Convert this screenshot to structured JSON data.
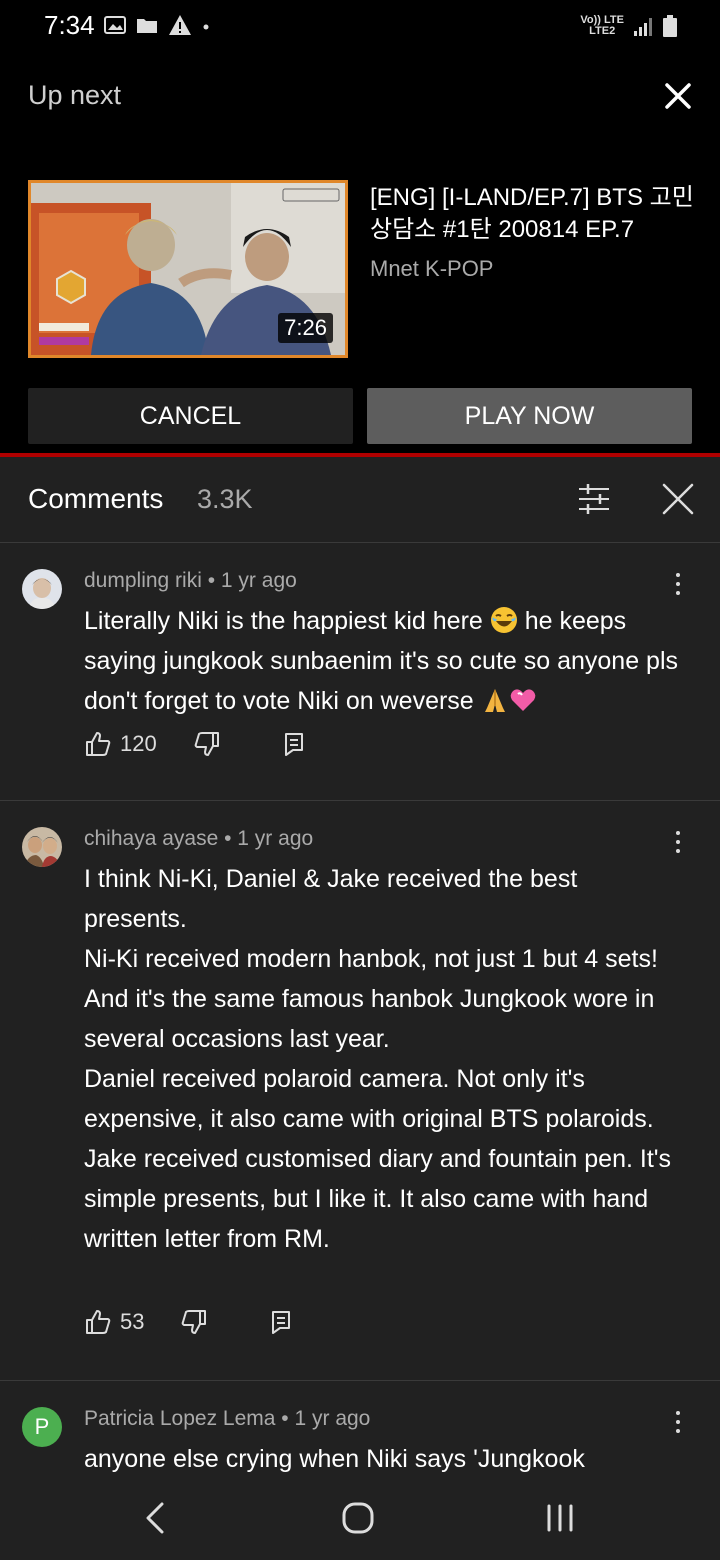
{
  "status_bar": {
    "time": "7:34",
    "network_top": "Vo)) LTE",
    "network_bottom": "LTE2"
  },
  "up_next": {
    "label": "Up next",
    "video_title": "[ENG] [I-LAND/EP.7] BTS 고민 상담소 #1탄 200814 EP.7",
    "channel": "Mnet K-POP",
    "duration": "7:26",
    "cancel_label": "CANCEL",
    "play_label": "PLAY NOW"
  },
  "comments_header": {
    "title": "Comments",
    "count": "3.3K"
  },
  "comments": [
    {
      "author": "dumpling riki",
      "time": "1 yr ago",
      "text_a": "Literally Niki is the happiest kid here",
      "text_b": "he keeps saying jungkook sunbaenim it's so cute so anyone pls don't forget to vote Niki on weverse",
      "likes": "120"
    },
    {
      "author": "chihaya ayase",
      "time": "1 yr ago",
      "lines": [
        "I think Ni-Ki, Daniel & Jake received the best presents.",
        "Ni-Ki received modern hanbok, not just 1 but 4 sets! And it's the same famous hanbok Jungkook wore in several occasions last year.",
        "Daniel received polaroid camera. Not only it's expensive, it also came with original BTS polaroids.",
        "Jake received customised diary and fountain pen. It's simple presents, but I like it. It also came with hand written letter from RM."
      ],
      "likes": "53"
    },
    {
      "author": "Patricia Lopez Lema",
      "time": "1 yr ago",
      "avatar_letter": "P",
      "text": "anyone else crying when Niki says 'Jungkook"
    }
  ],
  "colors": {
    "accent_red": "#b00000",
    "thumbnail_border": "#e0872a",
    "panel_bg": "#212121",
    "avatar_green": "#4caf50"
  },
  "icons": {
    "close": "close-icon",
    "filter": "sort-filter-icon",
    "like": "thumbs-up-icon",
    "dislike": "thumbs-down-icon",
    "reply": "reply-icon",
    "more": "more-vert-icon"
  }
}
